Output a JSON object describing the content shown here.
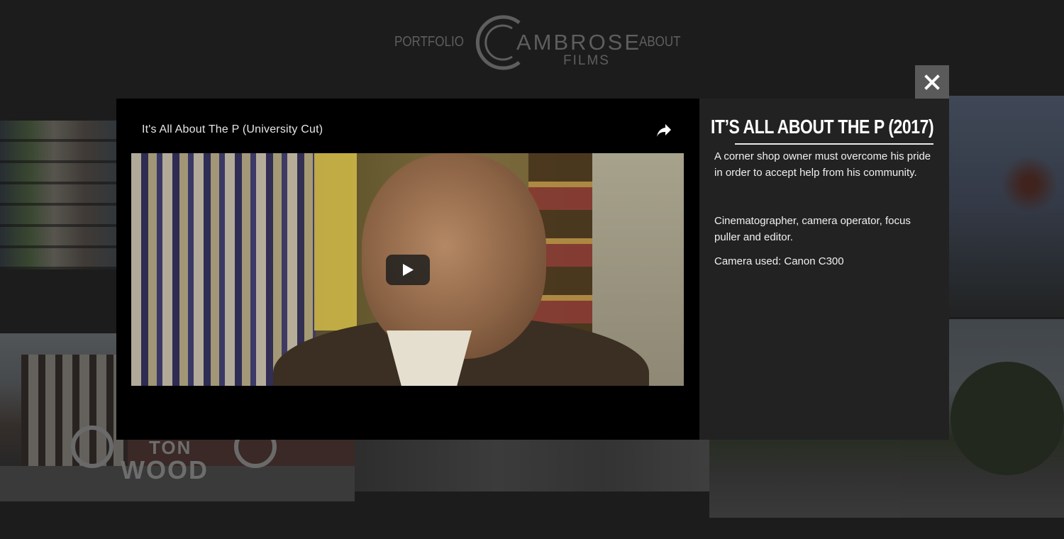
{
  "nav": {
    "portfolio_label": "PORTFOLIO",
    "about_label": "ABOUT",
    "logo_brand": "AMBROSE",
    "logo_sub": "FILMS"
  },
  "background_tiles": {
    "street_logo_text_top": "TON",
    "street_logo_text_bottom": "WOOD"
  },
  "video": {
    "title": "It's All About The P (University Cut)",
    "share_icon": "share-icon",
    "play_icon": "play-icon"
  },
  "info": {
    "title": "IT’S ALL ABOUT THE P (2017)",
    "description": "A corner shop owner must overcome his pride in order to accept help from his community.",
    "credits": "Cinematographer, camera operator, focus puller and editor.",
    "camera": "Camera used: Canon C300"
  },
  "close": {
    "icon": "close-icon"
  },
  "colors": {
    "page_background": "#1c1c1c",
    "nav_text": "#5e5e5e",
    "video_background": "#000000",
    "panel_background": "#222222",
    "close_button": "#5a5a5a"
  }
}
